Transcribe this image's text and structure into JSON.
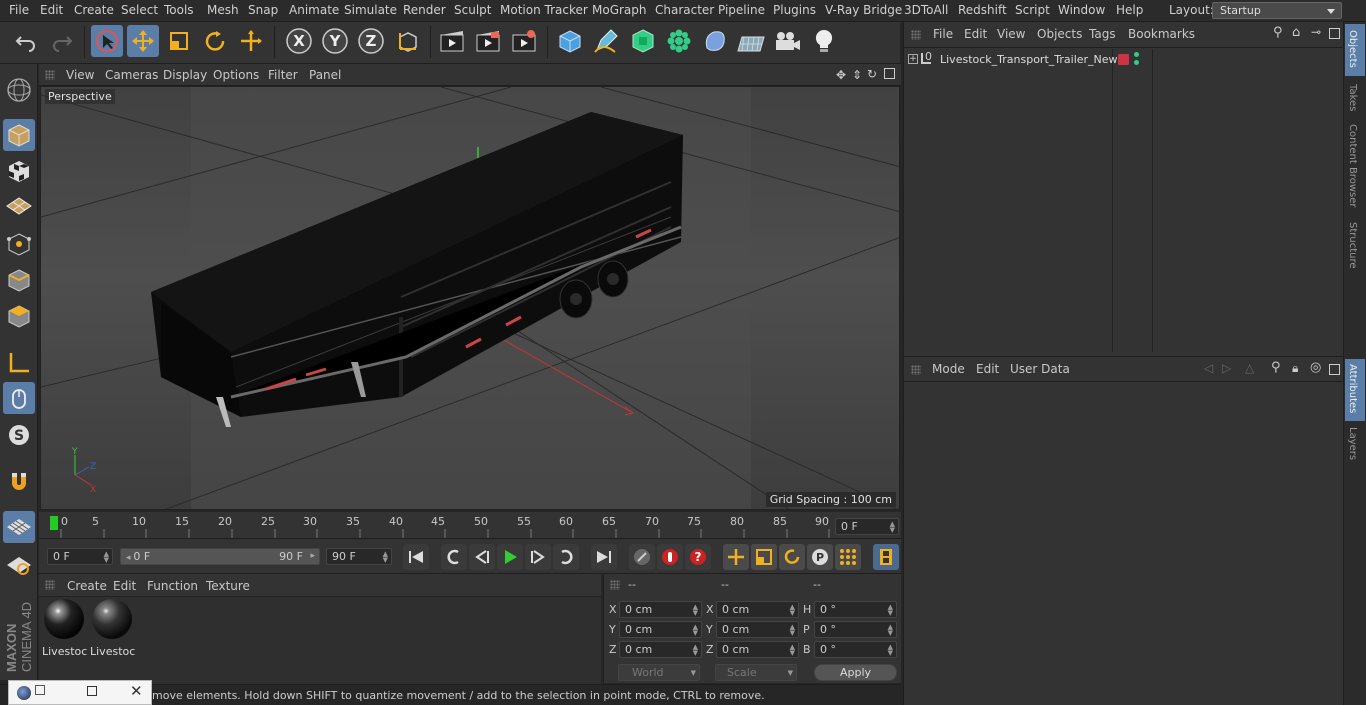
{
  "menubar": {
    "items": [
      "File",
      "Edit",
      "Create",
      "Select",
      "Tools",
      "Mesh",
      "Snap",
      "Animate",
      "Simulate",
      "Render",
      "Sculpt",
      "Motion Tracker",
      "MoGraph",
      "Character",
      "Pipeline",
      "Plugins",
      "V-Ray Bridge",
      "3DToAll",
      "Redshift",
      "Script",
      "Window",
      "Help"
    ],
    "layout_label": "Layout:",
    "layout_value": "Startup"
  },
  "toolbar": {
    "icons": [
      "undo-icon",
      "redo-icon",
      "select-arrow-icon",
      "move-icon",
      "scale-icon",
      "rotate-icon",
      "transform-icon",
      "axis-x-icon",
      "axis-y-icon",
      "axis-z-icon",
      "world-coords-icon",
      "render-view-icon",
      "render-picture-icon",
      "render-settings-icon",
      "cube-icon",
      "pen-icon",
      "subdivide-icon",
      "cloner-icon",
      "deformer-icon",
      "floor-icon",
      "camera-icon",
      "light-icon"
    ],
    "axis_labels": [
      "X",
      "Y",
      "Z"
    ]
  },
  "viewport": {
    "menu": [
      "View",
      "Cameras",
      "Display",
      "Options",
      "Filter",
      "Panel"
    ],
    "label": "Perspective",
    "grid_spacing": "Grid Spacing : 100 cm"
  },
  "timeline": {
    "ticks": [
      "0",
      "5",
      "10",
      "15",
      "20",
      "25",
      "30",
      "35",
      "40",
      "45",
      "50",
      "55",
      "60",
      "65",
      "70",
      "75",
      "80",
      "85",
      "90"
    ],
    "current_frame": "0 F"
  },
  "anim": {
    "start_frame": "0 F",
    "range_start": "0 F",
    "range_end": "90 F",
    "end_frame": "90 F"
  },
  "materials": {
    "menu": [
      "Create",
      "Edit",
      "Function",
      "Texture"
    ],
    "items": [
      "Livestoc",
      "Livestoc"
    ]
  },
  "coords": {
    "headers": [
      "--",
      "--",
      "--"
    ],
    "rows": [
      {
        "a": "X",
        "av": "0 cm",
        "b": "X",
        "bv": "0 cm",
        "c": "H",
        "cv": "0 °"
      },
      {
        "a": "Y",
        "av": "0 cm",
        "b": "Y",
        "bv": "0 cm",
        "c": "P",
        "cv": "0 °"
      },
      {
        "a": "Z",
        "av": "0 cm",
        "b": "Z",
        "bv": "0 cm",
        "c": "B",
        "cv": "0 °"
      }
    ],
    "world": "World",
    "scale": "Scale",
    "apply": "Apply"
  },
  "status": "move elements. Hold down SHIFT to quantize movement / add to the selection in point mode, CTRL to remove.",
  "objects": {
    "menu": [
      "File",
      "Edit",
      "View",
      "Objects",
      "Tags",
      "Bookmarks"
    ],
    "item": "Livestock_Transport_Trailer_New"
  },
  "attributes": {
    "menu": [
      "Mode",
      "Edit",
      "User Data"
    ]
  },
  "side_tabs": [
    "Objects",
    "Takes",
    "Content Browser",
    "Structure",
    "Attributes",
    "Layers"
  ],
  "brand": {
    "maxon": "MAXON",
    "product": "CINEMA 4D"
  },
  "colors": {
    "accent": "#5b7ea8",
    "axis_x": "#c33",
    "axis_y": "#3c3",
    "axis_z": "#36c"
  }
}
